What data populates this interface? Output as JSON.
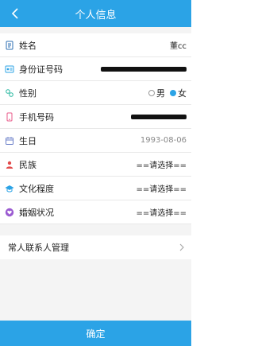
{
  "header": {
    "title": "个人信息"
  },
  "fields": {
    "name": {
      "label": "姓名",
      "value": "董cc"
    },
    "id": {
      "label": "身份证号码"
    },
    "gender": {
      "label": "性别",
      "options": [
        "男",
        "女"
      ],
      "selected": "女"
    },
    "phone": {
      "label": "手机号码"
    },
    "birthday": {
      "label": "生日",
      "value": "1993-08-06"
    },
    "ethnicity": {
      "label": "民族",
      "value": "==请选择=="
    },
    "education": {
      "label": "文化程度",
      "value": "==请选择=="
    },
    "marital": {
      "label": "婚姻状况",
      "value": "==请选择=="
    }
  },
  "contact": {
    "label": "常人联系人管理"
  },
  "footer": {
    "confirm_label": "确定"
  },
  "colors": {
    "accent": "#2ba3e6"
  }
}
